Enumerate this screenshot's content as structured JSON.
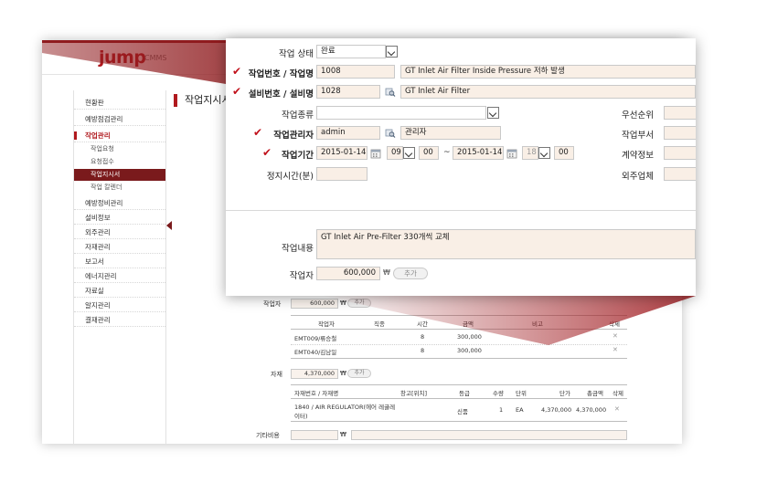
{
  "app": {
    "logo": "jump",
    "logo_sub": "CMMS"
  },
  "sidebar": {
    "items": [
      {
        "label": "현황판"
      },
      {
        "label": "예방점검관리"
      },
      {
        "label": "작업관리",
        "active": true
      },
      {
        "label": "예방정비관리"
      },
      {
        "label": "설비정보"
      },
      {
        "label": "외주관리"
      },
      {
        "label": "자재관리"
      },
      {
        "label": "보고서"
      },
      {
        "label": "에너지관리"
      },
      {
        "label": "자료실"
      },
      {
        "label": "알지관리"
      },
      {
        "label": "결재관리"
      }
    ],
    "sub_items": [
      {
        "label": "작업요청"
      },
      {
        "label": "요청접수"
      },
      {
        "label": "작업지시서",
        "selected": true
      },
      {
        "label": "작업 칼렌더"
      }
    ]
  },
  "back_page": {
    "title": "작업지시서",
    "worker_label": "작업자",
    "worker_amount": "600,000",
    "won": "₩",
    "add_label": "추가",
    "worker_table": {
      "headers": [
        "작업자",
        "직종",
        "시간",
        "금액",
        "비고",
        "삭제"
      ],
      "rows": [
        {
          "worker": "EMT009/류승철",
          "hours": "8",
          "amount": "300,000",
          "delete": "✕"
        },
        {
          "worker": "EMT040/김남일",
          "hours": "8",
          "amount": "300,000",
          "delete": "✕"
        }
      ]
    },
    "material_label": "자재",
    "material_amount": "4,370,000",
    "material_table": {
      "headers": [
        "자재번호 / 자재명",
        "창고[위치]",
        "등급",
        "수량",
        "단위",
        "단가",
        "총금액",
        "삭제"
      ],
      "rows": [
        {
          "name_line1": "1840 / AIR REGULATOR(에어 레귤레",
          "name_line2": "이터)",
          "grade": "신품",
          "qty": "1",
          "unit": "EA",
          "unit_price": "4,370,000",
          "total": "4,370,000",
          "delete": "✕"
        }
      ]
    },
    "other_cost_label": "기타비용"
  },
  "form": {
    "status": {
      "label": "작업 상태",
      "value": "완료"
    },
    "work_no": {
      "label": "작업번호 / 작업명",
      "number": "1008",
      "name": "GT Inlet Air Filter Inside Pressure 저하 발생"
    },
    "equip_no": {
      "label": "설비번호 / 설비명",
      "number": "1028",
      "name": "GT Inlet Air Filter"
    },
    "work_type": {
      "label": "작업종류",
      "value": ""
    },
    "manager": {
      "label": "작업관리자",
      "id": "admin",
      "name": "관리자"
    },
    "period": {
      "label": "작업기간",
      "start_date": "2015-01-14",
      "start_hour": "09",
      "start_min": "00",
      "tilde": "~",
      "end_date": "2015-01-14",
      "end_hour": "18",
      "end_min": "00"
    },
    "stop_time": {
      "label": "정지시간(분)",
      "value": ""
    },
    "priority": {
      "label": "우선순위"
    },
    "dept": {
      "label": "작업부서"
    },
    "contract": {
      "label": "계약정보"
    },
    "vendor": {
      "label": "외주업체"
    },
    "content": {
      "label": "작업내용",
      "value": "GT Inlet Air Pre-Filter 330개씩 교체"
    },
    "worker": {
      "label": "작업자",
      "amount": "600,000",
      "won": "₩",
      "add_label": "추가"
    }
  },
  "colors": {
    "brand": "#b0191e",
    "input_bg": "#f9efe6",
    "selected_menu": "#7a1a1c"
  }
}
